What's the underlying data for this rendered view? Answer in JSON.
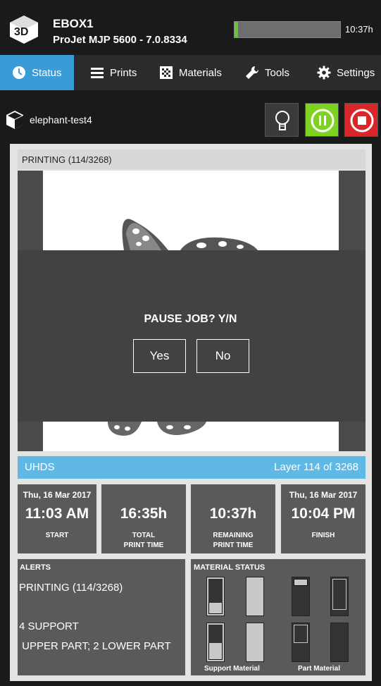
{
  "header": {
    "printer_name": "EBOX1",
    "printer_model": "ProJet MJP 5600 - 7.0.8334",
    "progress_fraction": 0.035,
    "time_remaining": "10:37h"
  },
  "nav": {
    "status": "Status",
    "prints": "Prints",
    "materials": "Materials",
    "tools": "Tools",
    "settings": "Settings"
  },
  "job": {
    "name": "elephant-test4"
  },
  "printing_status": "PRINTING (114/3268)",
  "modal": {
    "title": "PAUSE JOB? Y/N",
    "yes": "Yes",
    "no": "No"
  },
  "layer_bar": {
    "mode": "UHDS",
    "layer_text": "Layer 114 of 3268"
  },
  "tiles": {
    "start": {
      "date": "Thu, 16 Mar 2017",
      "value": "11:03 AM",
      "label": "START"
    },
    "total": {
      "value": "16:35h",
      "label_1": "TOTAL",
      "label_2": "PRINT TIME"
    },
    "remaining": {
      "value": "10:37h",
      "label_1": "REMAINING",
      "label_2": "PRINT TIME"
    },
    "finish": {
      "date": "Thu, 16 Mar 2017",
      "value": "10:04 PM",
      "label": "FINISH"
    }
  },
  "alerts": {
    "title": "ALERTS",
    "line1": "PRINTING (114/3268)",
    "line2": "4 SUPPORT",
    "line3": " UPPER PART; 2 LOWER PART"
  },
  "material_status": {
    "title": "MATERIAL STATUS",
    "support_label": "Support Material",
    "part_label": "Part Material"
  },
  "colors": {
    "accent_blue": "#3a9bd9",
    "layer_blue": "#5fb8e6",
    "pause_green": "#7ed321",
    "stop_red": "#d9262b",
    "progress_green": "#6fc22e"
  }
}
